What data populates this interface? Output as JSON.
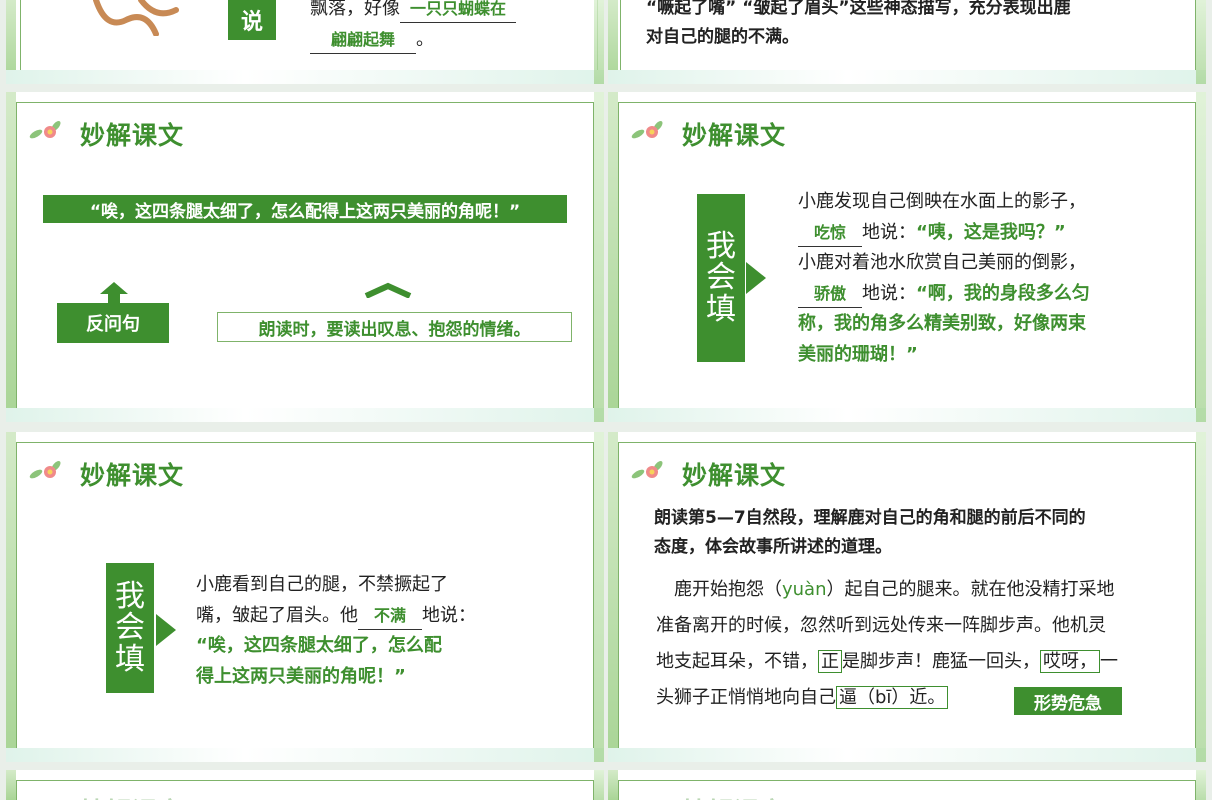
{
  "slides": {
    "top_left": {
      "tag": "说",
      "line1": "飘落，好像",
      "blank1": "一只只蝴蝶在",
      "blank2": "翩翩起舞",
      "end": "。"
    },
    "top_right": {
      "line1": "“噘起了嘴” “皱起了眉头”这些神态描写，充分表现出鹿",
      "line2": "对自己的腿的不满。"
    },
    "mid_left": {
      "heading": "妙解课文",
      "quote": "“唉，这四条腿太细了，怎么配得上这两只美丽的角呢！”",
      "label_left": "反问句",
      "label_right": "朗读时，要读出叹息、抱怨的情绪。"
    },
    "mid_right": {
      "heading": "妙解课文",
      "vertical": [
        "我",
        "会",
        "填"
      ],
      "p1a": "小鹿发现自己倒映在水面上的影子，",
      "blank1": "吃惊",
      "p1b": "地说：",
      "p1q": "“咦，这是我吗？”",
      "p2a": "小鹿对着池水欣赏自己美丽的倒影，",
      "blank2": "骄傲",
      "p2b": "地说：",
      "p2q1": "“啊，我的身段多么匀",
      "p2q2": "称，我的角多么精美别致，好像两束",
      "p2q3": "美丽的珊瑚！”"
    },
    "bot_left": {
      "heading": "妙解课文",
      "vertical": [
        "我",
        "会",
        "填"
      ],
      "l1": "小鹿看到自己的腿，不禁撅起了",
      "l2a": "嘴，皱起了眉头。他",
      "blank": "不满",
      "l2b": "地说：",
      "q1": "“唉，这四条腿太细了，怎么配",
      "q2": "得上这两只美丽的角呢！”"
    },
    "bot_right": {
      "heading": "妙解课文",
      "intro1": "朗读第5—7自然段，理解鹿对自己的角和腿的前后不同的",
      "intro2": "态度，体会故事所讲述的道理。",
      "p1a": "鹿开始抱怨（",
      "p1py": "yuàn",
      "p1b": "）起自己的腿来。就在他没精打采地",
      "p2": "准备离开的时候，忽然听到远处传来一阵脚步声。他机灵",
      "p3a": "地支起耳朵，不错，",
      "p3box1": "正",
      "p3b": "是脚步声！鹿猛一回头，",
      "p3box2": "哎呀，",
      "p3c": "一",
      "p4a": "头狮子正悄悄地向自己",
      "p4box": "逼（bī）近。",
      "badge": "形势危急"
    },
    "bottom_row": {
      "heading": "妙解课文"
    }
  },
  "colors": {
    "accent": "#3e8f2f",
    "frame": "#7fb36a"
  }
}
